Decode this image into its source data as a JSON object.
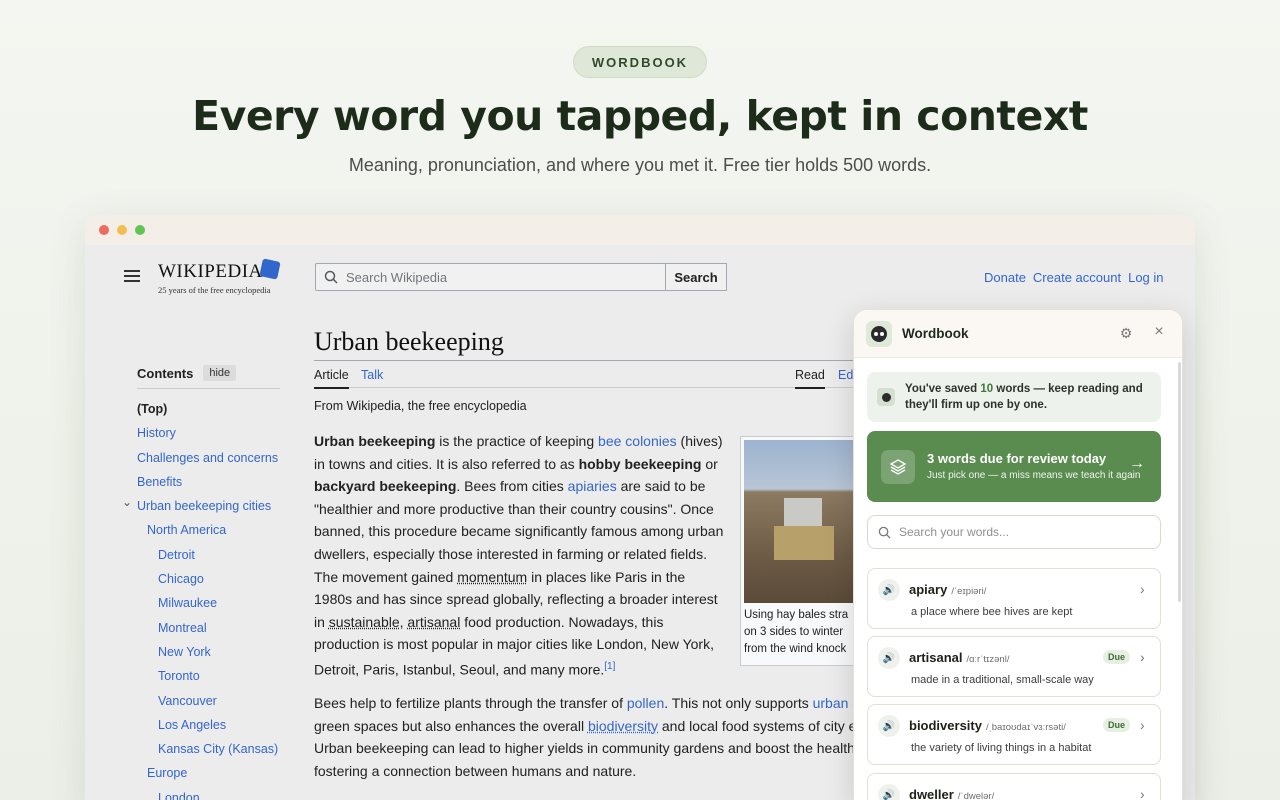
{
  "badge": "WORDBOOK",
  "headline": "Every word you tapped, kept in context",
  "subhead": "Meaning, pronunciation, and where you met it. Free tier holds 500 words.",
  "wikipedia": {
    "logo_name": "WIKIPEDIA",
    "logo_tagline": "25 years of the free encyclopedia",
    "search_placeholder": "Search Wikipedia",
    "search_button": "Search",
    "top_links": [
      "Donate",
      "Create account",
      "Log in"
    ],
    "toc_title": "Contents",
    "toc_hide": "hide",
    "toc_items": [
      {
        "label": "(Top)",
        "level": 0
      },
      {
        "label": "History",
        "level": 0
      },
      {
        "label": "Challenges and concerns",
        "level": 0
      },
      {
        "label": "Benefits",
        "level": 0
      },
      {
        "label": "Urban beekeeping cities",
        "level": 0
      },
      {
        "label": "North America",
        "level": 1
      },
      {
        "label": "Detroit",
        "level": 2
      },
      {
        "label": "Chicago",
        "level": 2
      },
      {
        "label": "Milwaukee",
        "level": 2
      },
      {
        "label": "Montreal",
        "level": 2
      },
      {
        "label": "New York",
        "level": 2
      },
      {
        "label": "Toronto",
        "level": 2
      },
      {
        "label": "Vancouver",
        "level": 2
      },
      {
        "label": "Los Angeles",
        "level": 2
      },
      {
        "label": "Kansas City (Kansas)",
        "level": 2
      },
      {
        "label": "Europe",
        "level": 1
      },
      {
        "label": "London",
        "level": 2
      }
    ],
    "article_title": "Urban beekeeping",
    "tab_article": "Article",
    "tab_talk": "Talk",
    "tab_read": "Read",
    "tab_edit": "Ed",
    "from_wiki": "From Wikipedia, the free encyclopedia",
    "caption_lines": [
      "Using hay bales stra",
      "on 3 sides to winter",
      "from the wind knock"
    ],
    "caption_link": "winter"
  },
  "panel": {
    "title": "Wordbook",
    "note_prefix": "You've saved ",
    "note_count": "10",
    "note_suffix": " words — keep reading and they'll firm up one by one.",
    "review_title": "3 words due for review today",
    "review_sub": "Just pick one — a miss means we teach it again",
    "search_placeholder": "Search your words...",
    "words": [
      {
        "word": "apiary",
        "pron": "/ˈeɪpiəri/",
        "def": "a place where bee hives are kept",
        "due": ""
      },
      {
        "word": "artisanal",
        "pron": "/ɑːrˈtɪzənl/",
        "def": "made in a traditional, small-scale way",
        "due": "Due"
      },
      {
        "word": "biodiversity",
        "pron": "/ˌbaɪoʊdaɪˈvɜːrsəti/",
        "def": "the variety of living things in a habitat",
        "due": "Due"
      },
      {
        "word": "dweller",
        "pron": "/ˈdwelər/",
        "def": "",
        "due": ""
      }
    ]
  },
  "colors": {
    "accent_green": "#5a8c50",
    "link_blue": "#3366cc"
  }
}
